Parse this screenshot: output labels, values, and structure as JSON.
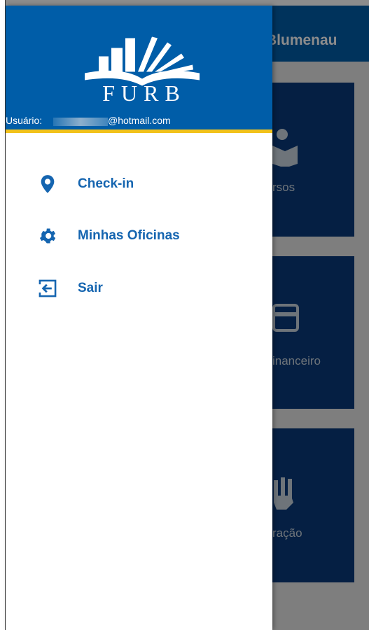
{
  "app": {
    "title_partial": "Blumenau",
    "tiles": [
      {
        "label": "rsos",
        "icon": "book-person-icon"
      },
      {
        "label": "inanceiro",
        "icon": "credit-card-icon"
      },
      {
        "label": "ração",
        "icon": "hand-icon"
      }
    ]
  },
  "drawer": {
    "logo_text": "FURB",
    "user_label": "Usuário:",
    "user_email_domain": "@hotmail.com",
    "menu": [
      {
        "label": "Check-in",
        "icon": "location-pin-icon"
      },
      {
        "label": "Minhas Oficinas",
        "icon": "gear-icon"
      },
      {
        "label": "Sair",
        "icon": "exit-icon"
      }
    ]
  },
  "colors": {
    "brand_blue": "#005da8",
    "accent_yellow": "#f2c21b",
    "menu_text": "#1565b0",
    "tile_blue": "#0a3a7a"
  }
}
